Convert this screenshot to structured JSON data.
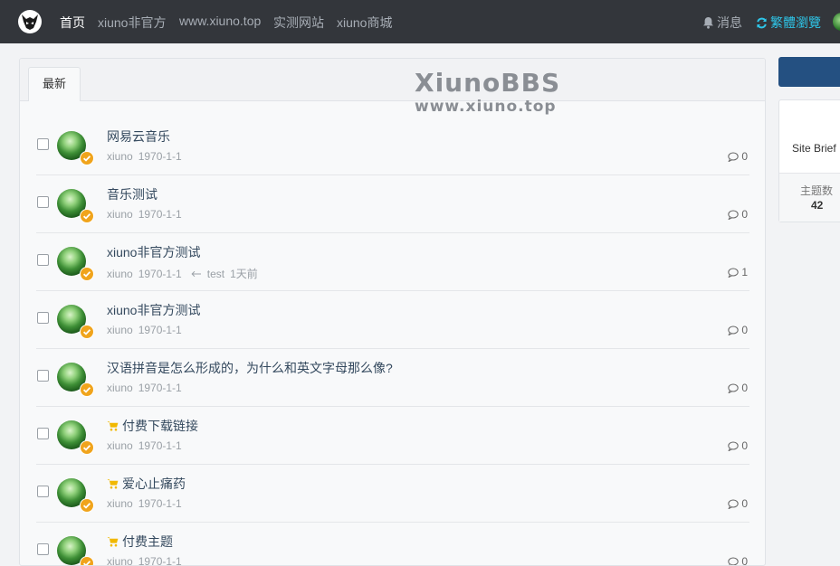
{
  "nav": {
    "items": [
      {
        "label": "首页",
        "active": true
      },
      {
        "label": "xiuno非官方",
        "active": false
      },
      {
        "label": "www.xiuno.top",
        "active": false
      },
      {
        "label": "实测网站",
        "active": false
      },
      {
        "label": "xiuno商城",
        "active": false
      }
    ],
    "messages_label": "消息",
    "traditional_label": "繁體瀏覽"
  },
  "tabs": [
    {
      "label": "最新"
    }
  ],
  "watermark": {
    "title": "XiunoBBS",
    "url": "www.xiuno.top"
  },
  "threads": [
    {
      "title": "网易云音乐",
      "author": "xiuno",
      "date": "1970-1-1",
      "replies": "0",
      "paid": false
    },
    {
      "title": "音乐测试",
      "author": "xiuno",
      "date": "1970-1-1",
      "replies": "0",
      "paid": false
    },
    {
      "title": "xiuno非官方测试",
      "author": "xiuno",
      "date": "1970-1-1",
      "last_user": "test",
      "last_time": "1天前",
      "replies": "1",
      "paid": false
    },
    {
      "title": "xiuno非官方测试",
      "author": "xiuno",
      "date": "1970-1-1",
      "replies": "0",
      "paid": false
    },
    {
      "title": "汉语拼音是怎么形成的，为什么和英文字母那么像?",
      "author": "xiuno",
      "date": "1970-1-1",
      "replies": "0",
      "paid": false
    },
    {
      "title": "付费下载链接",
      "author": "xiuno",
      "date": "1970-1-1",
      "replies": "0",
      "paid": true
    },
    {
      "title": "爱心止痛药",
      "author": "xiuno",
      "date": "1970-1-1",
      "replies": "0",
      "paid": true
    },
    {
      "title": "付费主题",
      "author": "xiuno",
      "date": "1970-1-1",
      "replies": "0",
      "paid": true
    }
  ],
  "sidebar": {
    "site_brief": "Site Brief",
    "stats": [
      {
        "label": "主题数",
        "value": "42"
      }
    ]
  },
  "colors": {
    "topbar": "#33363b",
    "accent_cyan": "#2ec5e8",
    "sidebar_button": "#245081",
    "title_text": "#34495e",
    "cart_icon": "#f1b800",
    "badge": "#f0a41c"
  },
  "icons": {
    "logo": "horned-helmet-icon",
    "messages": "bell-icon",
    "traditional": "refresh-icon",
    "replies": "comment-icon",
    "paid": "shopping-cart-icon",
    "verified": "verified-badge-icon"
  }
}
